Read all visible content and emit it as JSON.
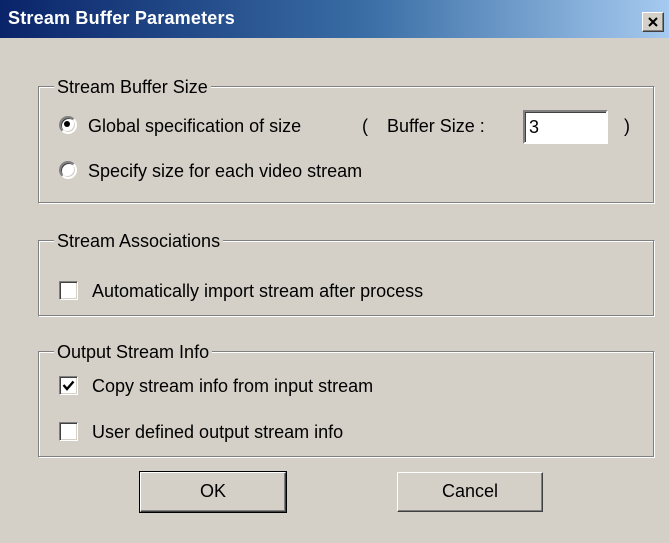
{
  "window": {
    "title": "Stream Buffer Parameters"
  },
  "buffer_size_group": {
    "label": "Stream Buffer Size",
    "option_global": {
      "label": "Global specification of size",
      "selected": true
    },
    "paren_open": "(",
    "buffer_size_label": "Buffer Size :",
    "buffer_size_value": "3",
    "paren_close": ")",
    "option_each": {
      "label": "Specify size for each video stream",
      "selected": false
    }
  },
  "associations_group": {
    "label": "Stream Associations",
    "auto_import": {
      "label": "Automatically import stream after process",
      "checked": false
    }
  },
  "output_group": {
    "label": "Output Stream Info",
    "copy_info": {
      "label": "Copy stream info from input stream",
      "checked": true
    },
    "user_defined": {
      "label": "User defined output stream info",
      "checked": false
    }
  },
  "buttons": {
    "ok": "OK",
    "cancel": "Cancel"
  },
  "colors": {
    "title_gradient_start": "#0a246a",
    "title_gradient_end": "#a6caf0",
    "face": "#d4d0c8"
  },
  "icons": {
    "close": "close-icon",
    "check": "checkmark-icon"
  }
}
